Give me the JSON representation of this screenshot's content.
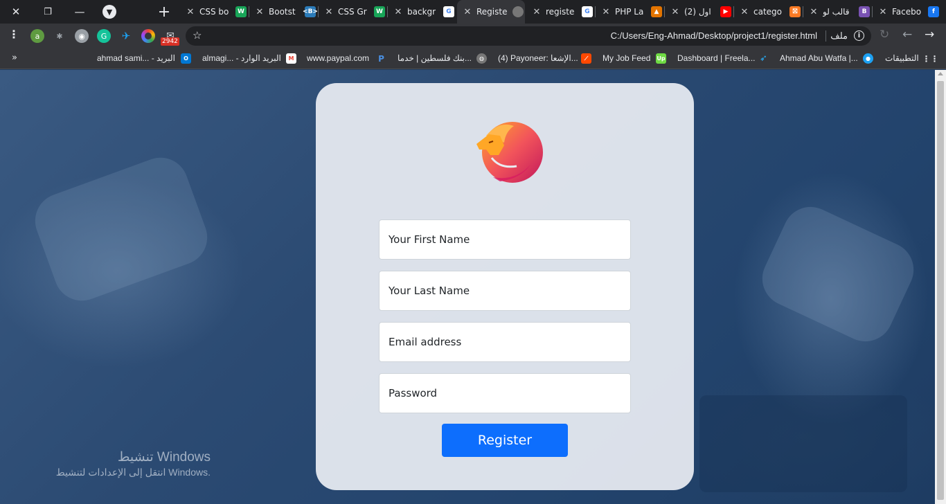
{
  "window_controls": {
    "close": "✕",
    "restore": "❐",
    "minimize": "—"
  },
  "tabs": [
    {
      "title": "CSS bo",
      "favicon_color": "#18a558",
      "favicon_text": "W"
    },
    {
      "title": "Bootst",
      "favicon_color": "#2b7bb9",
      "favicon_text": "<B>"
    },
    {
      "title": "CSS Gr",
      "favicon_color": "#18a558",
      "favicon_text": "W"
    },
    {
      "title": "backgr",
      "favicon_color": "#ffffff",
      "favicon_text": "G"
    },
    {
      "title": "Registe",
      "favicon_color": "#777777",
      "favicon_text": "",
      "active": true
    },
    {
      "title": "registe",
      "favicon_color": "#ffffff",
      "favicon_text": "G"
    },
    {
      "title": "PHP La",
      "favicon_color": "#e37400",
      "favicon_text": "▲"
    },
    {
      "title": "(2) اول",
      "favicon_color": "#ff0000",
      "favicon_text": "▶"
    },
    {
      "title": "catego",
      "favicon_color": "#fb7a24",
      "favicon_text": "⛝"
    },
    {
      "title": "قالب لو",
      "favicon_color": "#7952b3",
      "favicon_text": "B"
    },
    {
      "title": "Facebo",
      "favicon_color": "#1877f2",
      "favicon_text": "f"
    }
  ],
  "toolbar": {
    "mail_badge": "2942",
    "url": "C:/Users/Eng-Ahmad/Desktop/project1/register.html",
    "file_label": "ملف"
  },
  "bookmarks": [
    {
      "label": "ahmad sami... - البريد",
      "icon": "outlook",
      "color": "#0078d4"
    },
    {
      "label": "almagi... - البريد الوارد",
      "icon": "gmail",
      "color": "#ea4335"
    },
    {
      "label": "www.paypal.com",
      "icon": "paypal",
      "color": "#003087"
    },
    {
      "label": "بنك فلسطين | خدما...",
      "icon": "globe",
      "color": "#777777"
    },
    {
      "label": "(4) Payoneer: الإشعا...",
      "icon": "payoneer",
      "color": "#ff4800"
    },
    {
      "label": "My Job Feed",
      "icon": "upwork",
      "color": "#6fda44"
    },
    {
      "label": "Dashboard | Freela...",
      "icon": "freelancer",
      "color": "#29b2fe"
    },
    {
      "label": "Ahmad Abu Watfa |...",
      "icon": "circle",
      "color": "#1da1f2"
    },
    {
      "label": "التطبيقات",
      "icon": "apps",
      "color": "#e8eaed"
    }
  ],
  "form": {
    "first_name_placeholder": "Your First Name",
    "last_name_placeholder": "Your Last Name",
    "email_placeholder": "Email address",
    "password_placeholder": "Password",
    "submit_label": "Register"
  },
  "activation": {
    "title": "تنشيط Windows",
    "subtitle": "انتقل إلى الإعدادات لتنشيط Windows."
  },
  "colors": {
    "primary_button": "#0d6efd",
    "card_bg": "#e9edf3",
    "page_bg": "#2b4a72"
  }
}
